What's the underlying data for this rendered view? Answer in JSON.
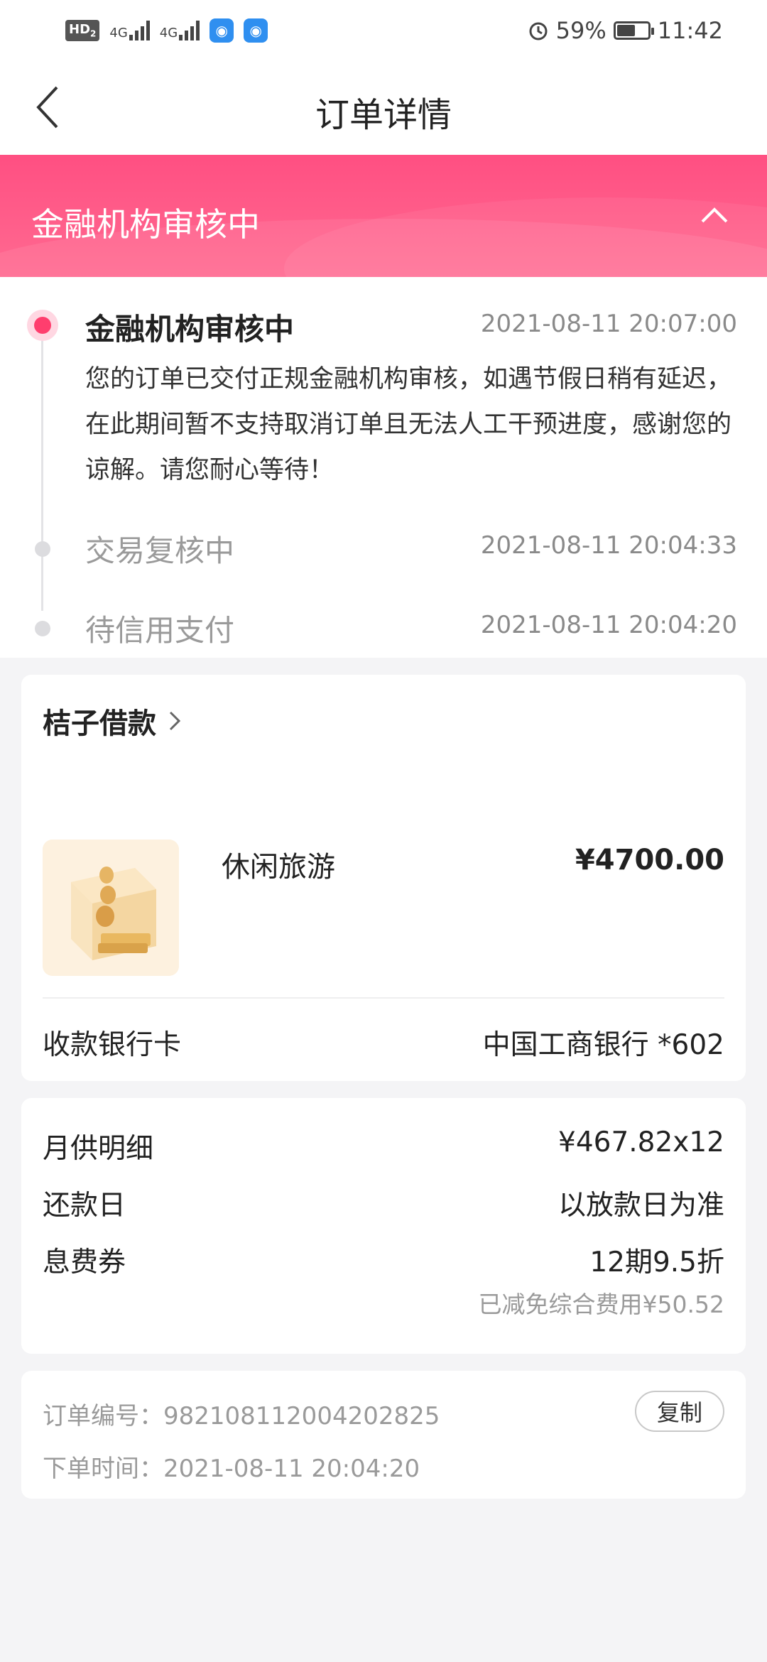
{
  "status_bar": {
    "hd_badge": "HD",
    "hd_sub": "2",
    "net1": "4G",
    "net2": "4G",
    "battery_percent": "59%",
    "battery_level": 0.59,
    "time": "11:42"
  },
  "header": {
    "title": "订单详情"
  },
  "banner": {
    "title": "金融机构审核中"
  },
  "timeline": [
    {
      "title": "金融机构审核中",
      "time": "2021-08-11 20:07:00",
      "desc": "您的订单已交付正规金融机构审核，如遇节假日稍有延迟，在此期间暂不支持取消订单且无法人工干预进度，感谢您的谅解。请您耐心等待！"
    },
    {
      "title": "交易复核中",
      "time": "2021-08-11 20:04:33"
    },
    {
      "title": "待信用支付",
      "time": "2021-08-11 20:04:20"
    }
  ],
  "loan": {
    "lender": "桔子借款",
    "product_name": "休闲旅游",
    "price": "¥4700.00",
    "bank_label": "收款银行卡",
    "bank_value": "中国工商银行 *602"
  },
  "repayment": {
    "monthly_label": "月供明细",
    "monthly_value": "¥467.82x12",
    "due_label": "还款日",
    "due_value": "以放款日为准",
    "coupon_label": "息费券",
    "coupon_value": "12期9.5折",
    "discount_note": "已减免综合费用¥50.52"
  },
  "order": {
    "number_line": "订单编号：982108112004202825",
    "time_line": "下单时间：2021-08-11 20:04:20",
    "copy_label": "复制"
  },
  "colors": {
    "accent": "#ff4f82",
    "active_dot": "#ff3e6e"
  }
}
